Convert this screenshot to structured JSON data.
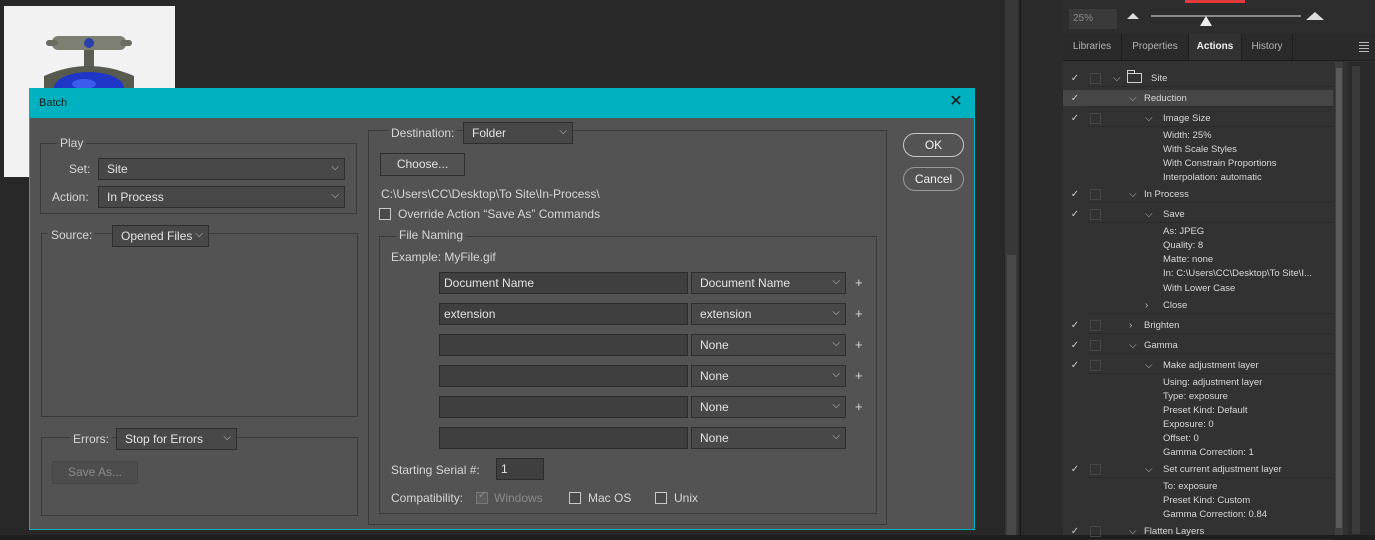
{
  "dialog": {
    "title": "Batch",
    "close_icon": "close-icon",
    "ok_label": "OK",
    "cancel_label": "Cancel",
    "play": {
      "legend": "Play",
      "set_label": "Set:",
      "set_value": "Site",
      "action_label": "Action:",
      "action_value": "In Process"
    },
    "source": {
      "label": "Source:",
      "value": "Opened Files"
    },
    "errors": {
      "label": "Errors:",
      "value": "Stop for Errors",
      "save_as_label": "Save As..."
    },
    "destination": {
      "label": "Destination:",
      "value": "Folder",
      "choose_label": "Choose...",
      "path": "C:\\Users\\CC\\Desktop\\To Site\\In-Process\\",
      "override_label": "Override Action “Save As” Commands"
    },
    "file_naming": {
      "legend": "File Naming",
      "example": "Example: MyFile.gif",
      "rows": [
        {
          "field": "Document Name",
          "select": "Document Name",
          "plus": "+"
        },
        {
          "field": "extension",
          "select": "extension",
          "plus": "+"
        },
        {
          "field": "",
          "select": "None",
          "plus": "+"
        },
        {
          "field": "",
          "select": "None",
          "plus": "+"
        },
        {
          "field": "",
          "select": "None",
          "plus": "+"
        },
        {
          "field": "",
          "select": "None",
          "plus": ""
        }
      ],
      "serial_label": "Starting Serial #:",
      "serial_value": "1",
      "compat_label": "Compatibility:",
      "compat_windows": "Windows",
      "compat_mac": "Mac OS",
      "compat_unix": "Unix"
    }
  },
  "panel": {
    "zoom_value": "25%",
    "tabs": [
      "Libraries",
      "Properties",
      "Actions",
      "History"
    ],
    "active_tab": "Actions",
    "actions": [
      {
        "label": "Site",
        "check": "✓",
        "twirl": "⌵",
        "level": 0
      },
      {
        "label": "Reduction",
        "check": "✓",
        "twirl": "⌵",
        "level": 1,
        "highlight": true
      },
      {
        "label": "Image Size",
        "check": "✓",
        "twirl": "⌵",
        "level": 2
      },
      {
        "label": "Width: 25%",
        "level": 3
      },
      {
        "label": "With Scale Styles",
        "level": 3
      },
      {
        "label": "With Constrain Proportions",
        "level": 3
      },
      {
        "label": "Interpolation: automatic",
        "level": 3
      },
      {
        "label": "In Process",
        "check": "✓",
        "twirl": "⌵",
        "level": 1
      },
      {
        "label": "Save",
        "check": "✓",
        "twirl": "⌵",
        "level": 2
      },
      {
        "label": "As: JPEG",
        "level": 3
      },
      {
        "label": "Quality: 8",
        "level": 3
      },
      {
        "label": "Matte: none",
        "level": 3
      },
      {
        "label": "In: C:\\Users\\CC\\Desktop\\To Site\\I...",
        "level": 3
      },
      {
        "label": "With Lower Case",
        "level": 3
      },
      {
        "label": "Close",
        "twirl": "›",
        "level": 2
      },
      {
        "label": "Brighten",
        "check": "✓",
        "twirl": "›",
        "level": 1
      },
      {
        "label": "Gamma",
        "check": "✓",
        "twirl": "⌵",
        "level": 1
      },
      {
        "label": "Make adjustment layer",
        "check": "✓",
        "twirl": "⌵",
        "level": 2
      },
      {
        "label": "Using: adjustment layer",
        "level": 3
      },
      {
        "label": "Type: exposure",
        "level": 3
      },
      {
        "label": "Preset Kind: Default",
        "level": 3
      },
      {
        "label": "Exposure: 0",
        "level": 3
      },
      {
        "label": "Offset: 0",
        "level": 3
      },
      {
        "label": "Gamma Correction: 1",
        "level": 3
      },
      {
        "label": "Set current adjustment layer",
        "check": "✓",
        "twirl": "⌵",
        "level": 2
      },
      {
        "label": "To: exposure",
        "level": 3
      },
      {
        "label": "Preset Kind: Custom",
        "level": 3
      },
      {
        "label": "Gamma Correction: 0.84",
        "level": 3
      },
      {
        "label": "Flatten Layers",
        "check": "✓",
        "twirl": "⌵",
        "level": 1
      }
    ]
  },
  "colors": {
    "dialog_accent": "#00b2bf",
    "dialog_bg": "#535353",
    "panel_bg": "#323232"
  }
}
